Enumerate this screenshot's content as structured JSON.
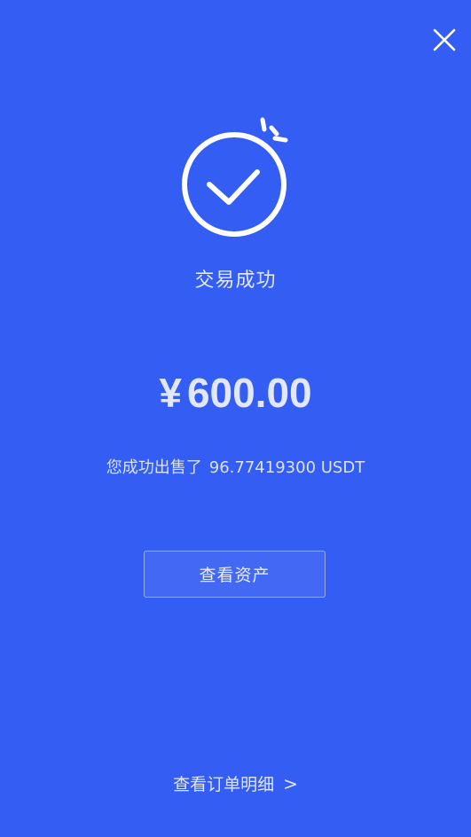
{
  "header": {
    "close_icon": "close-icon"
  },
  "result": {
    "icon": "checkmark-circle-icon",
    "status_text": "交易成功",
    "currency_symbol": "¥",
    "amount": "600.00",
    "sold_prefix": "您成功出售了",
    "sold_quantity": "96.77419300 USDT"
  },
  "actions": {
    "view_assets_label": "查看资产",
    "order_detail_label": "查看订单明细",
    "order_detail_chevron": ">"
  }
}
